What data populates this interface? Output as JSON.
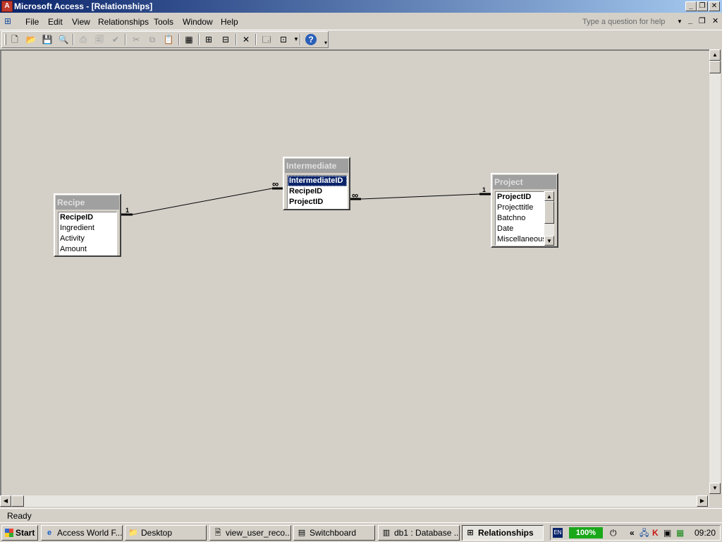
{
  "window": {
    "title": "Microsoft Access - [Relationships]",
    "controls": [
      "_",
      "❐",
      "✕"
    ]
  },
  "menu": {
    "items": [
      {
        "label": "File"
      },
      {
        "label": "Edit"
      },
      {
        "label": "View"
      },
      {
        "label": "Relationships"
      },
      {
        "label": "Tools"
      },
      {
        "label": "Window"
      },
      {
        "label": "Help"
      }
    ],
    "help_placeholder": "Type a question for help",
    "doc_controls": [
      "_",
      "❐",
      "✕"
    ]
  },
  "toolbar": {
    "buttons": [
      {
        "name": "new-icon",
        "glyph": "🗋"
      },
      {
        "name": "open-icon",
        "glyph": "📂"
      },
      {
        "name": "save-icon",
        "glyph": "💾"
      },
      {
        "name": "search-icon",
        "glyph": "🔍"
      },
      {
        "name": "print-icon",
        "glyph": "⎙"
      },
      {
        "name": "print-preview-icon",
        "glyph": "🗐"
      },
      {
        "name": "spelling-icon",
        "glyph": "✔"
      },
      {
        "name": "cut-icon",
        "glyph": "✂"
      },
      {
        "name": "copy-icon",
        "glyph": "⧉"
      },
      {
        "name": "paste-icon",
        "glyph": "📋"
      },
      {
        "name": "show-table-icon",
        "glyph": "▦"
      },
      {
        "name": "show-direct-icon",
        "glyph": "⊞"
      },
      {
        "name": "show-all-icon",
        "glyph": "⊟"
      },
      {
        "name": "delete-icon",
        "glyph": "✕"
      },
      {
        "name": "database-window-icon",
        "glyph": "🗔"
      },
      {
        "name": "new-object-icon",
        "glyph": "⊡"
      },
      {
        "name": "help-icon",
        "glyph": "?"
      }
    ]
  },
  "tables": [
    {
      "title": "Recipe",
      "fields": [
        {
          "label": "RecipeID",
          "pk": true,
          "selected": false
        },
        {
          "label": "Ingredient",
          "pk": false,
          "selected": false
        },
        {
          "label": "Activity",
          "pk": false,
          "selected": false
        },
        {
          "label": "Amount",
          "pk": false,
          "selected": false
        }
      ]
    },
    {
      "title": "Intermediate",
      "fields": [
        {
          "label": "IntermediateID",
          "pk": true,
          "selected": true
        },
        {
          "label": "RecipeID",
          "pk": true,
          "selected": false
        },
        {
          "label": "ProjectID",
          "pk": true,
          "selected": false
        }
      ]
    },
    {
      "title": "Project",
      "fields": [
        {
          "label": "ProjectID",
          "pk": true,
          "selected": false
        },
        {
          "label": "Projecttitle",
          "pk": false,
          "selected": false
        },
        {
          "label": "Batchno",
          "pk": false,
          "selected": false
        },
        {
          "label": "Date",
          "pk": false,
          "selected": false
        },
        {
          "label": "Miscellaneous",
          "pk": false,
          "selected": false
        }
      ]
    }
  ],
  "relationships": [
    {
      "from": "Recipe.RecipeID",
      "to": "Intermediate.RecipeID",
      "one_label": "1",
      "many_label": "∞"
    },
    {
      "from": "Project.ProjectID",
      "to": "Intermediate.ProjectID",
      "one_label": "1",
      "many_label": "∞"
    }
  ],
  "status": {
    "text": "Ready"
  },
  "taskbar": {
    "start_label": "Start",
    "tasks": [
      {
        "label": "Access World F...",
        "icon": "e",
        "active": false
      },
      {
        "label": "Desktop",
        "icon": "📁",
        "active": false
      },
      {
        "label": "view_user_reco...",
        "icon": "🗎",
        "active": false
      },
      {
        "label": "Switchboard",
        "icon": "▤",
        "active": false
      },
      {
        "label": "db1 : Database ...",
        "icon": "▥",
        "active": false
      },
      {
        "label": "Relationships",
        "icon": "⊞",
        "active": true
      }
    ],
    "tray": {
      "language": "EN",
      "battery": "100%",
      "collapse": "«",
      "clock": "09:20"
    }
  }
}
